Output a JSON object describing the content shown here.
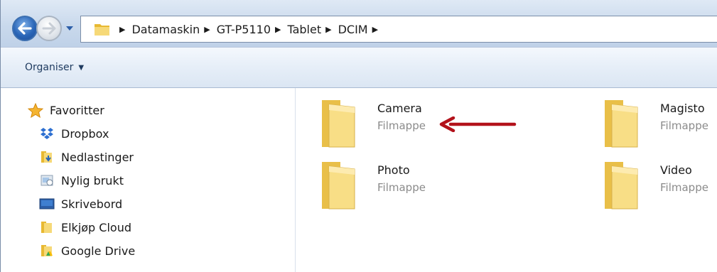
{
  "address_bar": {
    "breadcrumbs": [
      {
        "label": "Datamaskin"
      },
      {
        "label": "GT-P5110"
      },
      {
        "label": "Tablet"
      },
      {
        "label": "DCIM"
      }
    ]
  },
  "toolbar": {
    "organise_label": "Organiser"
  },
  "navigation": {
    "favorites_label": "Favoritter",
    "items": [
      {
        "label": "Dropbox",
        "icon": "dropbox-icon"
      },
      {
        "label": "Nedlastinger",
        "icon": "downloads-folder-icon"
      },
      {
        "label": "Nylig brukt",
        "icon": "recent-places-icon"
      },
      {
        "label": "Skrivebord",
        "icon": "desktop-icon"
      },
      {
        "label": "Elkjøp Cloud",
        "icon": "folder-icon"
      },
      {
        "label": "Google Drive",
        "icon": "google-drive-folder-icon"
      }
    ]
  },
  "folders": [
    {
      "name": "Camera",
      "type": "Filmappe"
    },
    {
      "name": "Magisto",
      "type": "Filmappe"
    },
    {
      "name": "Photo",
      "type": "Filmappe"
    },
    {
      "name": "Video",
      "type": "Filmappe"
    }
  ],
  "colors": {
    "annotation_arrow": "#b3121b",
    "folder_yellow": "#f3d36b",
    "address_bar_bg": "#c9d9ec"
  }
}
